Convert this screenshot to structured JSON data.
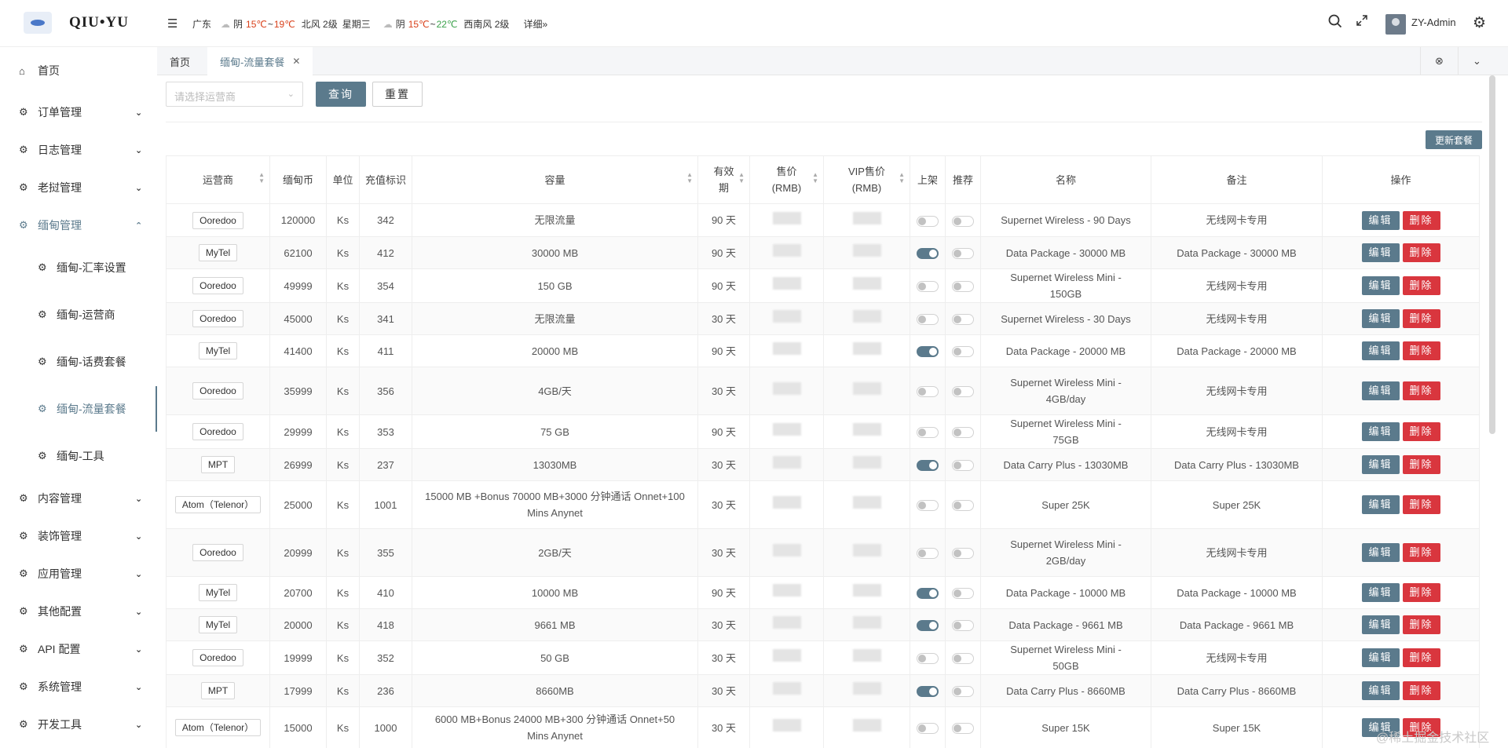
{
  "header": {
    "logo_text": "QIU•YU",
    "weather": {
      "province": "广东",
      "today": {
        "condition": "阴",
        "high": "15℃",
        "sep": "~",
        "low": "19℃",
        "wind": "北风 2级",
        "weekday": "星期三"
      },
      "tomorrow": {
        "condition": "阴",
        "high": "15℃",
        "sep": "~",
        "low": "22℃",
        "wind": "西南风 2级"
      },
      "detail_label": "详细»"
    },
    "user_name": "ZY-Admin"
  },
  "sidebar": {
    "items": [
      {
        "label": "首页"
      },
      {
        "label": "订单管理"
      },
      {
        "label": "日志管理"
      },
      {
        "label": "老挝管理"
      },
      {
        "label": "缅甸管理"
      },
      {
        "label": "内容管理"
      },
      {
        "label": "装饰管理"
      },
      {
        "label": "应用管理"
      },
      {
        "label": "其他配置"
      },
      {
        "label": "API 配置"
      },
      {
        "label": "系统管理"
      },
      {
        "label": "开发工具"
      }
    ],
    "sub_items": [
      {
        "label": "缅甸-汇率设置"
      },
      {
        "label": "缅甸-运营商"
      },
      {
        "label": "缅甸-话费套餐"
      },
      {
        "label": "缅甸-流量套餐"
      },
      {
        "label": "缅甸-工具"
      }
    ]
  },
  "tabs": [
    {
      "label": "首页"
    },
    {
      "label": "缅甸-流量套餐"
    }
  ],
  "filter": {
    "operator_placeholder": "请选择运营商",
    "query_label": "查询",
    "reset_label": "重置"
  },
  "toolbar": {
    "update_label": "更新套餐"
  },
  "table": {
    "headers": {
      "operator": "运营商",
      "coin": "缅甸币",
      "unit": "单位",
      "recharge_id": "充值标识",
      "capacity": "容量",
      "validity": "有效期",
      "price": "售价(RMB)",
      "vip_price": "VIP售价(RMB)",
      "listed": "上架",
      "recommend": "推荐",
      "name": "名称",
      "remark": "备注",
      "actions": "操作"
    },
    "edit_label": "编辑",
    "delete_label": "删除",
    "rows": [
      {
        "operator": "Ooredoo",
        "coin": "120000",
        "unit": "Ks",
        "recharge_id": "342",
        "capacity": "无限流量",
        "validity": "90 天",
        "listed": false,
        "recommend": false,
        "name": "Supernet Wireless - 90 Days",
        "remark": "无线网卡专用"
      },
      {
        "operator": "MyTel",
        "coin": "62100",
        "unit": "Ks",
        "recharge_id": "412",
        "capacity": "30000 MB",
        "validity": "90 天",
        "listed": true,
        "recommend": false,
        "name": "Data Package - 30000 MB",
        "remark": "Data Package - 30000 MB"
      },
      {
        "operator": "Ooredoo",
        "coin": "49999",
        "unit": "Ks",
        "recharge_id": "354",
        "capacity": "150 GB",
        "validity": "90 天",
        "listed": false,
        "recommend": false,
        "name": "Supernet Wireless Mini - 150GB",
        "remark": "无线网卡专用"
      },
      {
        "operator": "Ooredoo",
        "coin": "45000",
        "unit": "Ks",
        "recharge_id": "341",
        "capacity": "无限流量",
        "validity": "30 天",
        "listed": false,
        "recommend": false,
        "name": "Supernet Wireless - 30 Days",
        "remark": "无线网卡专用"
      },
      {
        "operator": "MyTel",
        "coin": "41400",
        "unit": "Ks",
        "recharge_id": "411",
        "capacity": "20000 MB",
        "validity": "90 天",
        "listed": true,
        "recommend": false,
        "name": "Data Package - 20000 MB",
        "remark": "Data Package - 20000 MB"
      },
      {
        "operator": "Ooredoo",
        "coin": "35999",
        "unit": "Ks",
        "recharge_id": "356",
        "capacity": "4GB/天",
        "validity": "30 天",
        "listed": false,
        "recommend": false,
        "name": "Supernet Wireless Mini - 4GB/day",
        "remark": "无线网卡专用"
      },
      {
        "operator": "Ooredoo",
        "coin": "29999",
        "unit": "Ks",
        "recharge_id": "353",
        "capacity": "75 GB",
        "validity": "90 天",
        "listed": false,
        "recommend": false,
        "name": "Supernet Wireless Mini - 75GB",
        "remark": "无线网卡专用"
      },
      {
        "operator": "MPT",
        "coin": "26999",
        "unit": "Ks",
        "recharge_id": "237",
        "capacity": "13030MB",
        "validity": "30 天",
        "listed": true,
        "recommend": false,
        "name": "Data Carry Plus - 13030MB",
        "remark": "Data Carry Plus - 13030MB"
      },
      {
        "operator": "Atom（Telenor）",
        "coin": "25000",
        "unit": "Ks",
        "recharge_id": "1001",
        "capacity": "15000 MB +Bonus 70000 MB+3000 分钟通话 Onnet+100 Mins Anynet",
        "validity": "30 天",
        "listed": false,
        "recommend": false,
        "name": "Super 25K",
        "remark": "Super 25K"
      },
      {
        "operator": "Ooredoo",
        "coin": "20999",
        "unit": "Ks",
        "recharge_id": "355",
        "capacity": "2GB/天",
        "validity": "30 天",
        "listed": false,
        "recommend": false,
        "name": "Supernet Wireless Mini - 2GB/day",
        "remark": "无线网卡专用"
      },
      {
        "operator": "MyTel",
        "coin": "20700",
        "unit": "Ks",
        "recharge_id": "410",
        "capacity": "10000 MB",
        "validity": "90 天",
        "listed": true,
        "recommend": false,
        "name": "Data Package - 10000 MB",
        "remark": "Data Package - 10000 MB"
      },
      {
        "operator": "MyTel",
        "coin": "20000",
        "unit": "Ks",
        "recharge_id": "418",
        "capacity": "9661 MB",
        "validity": "30 天",
        "listed": true,
        "recommend": false,
        "name": "Data Package - 9661 MB",
        "remark": "Data Package - 9661 MB"
      },
      {
        "operator": "Ooredoo",
        "coin": "19999",
        "unit": "Ks",
        "recharge_id": "352",
        "capacity": "50 GB",
        "validity": "30 天",
        "listed": false,
        "recommend": false,
        "name": "Supernet Wireless Mini - 50GB",
        "remark": "无线网卡专用"
      },
      {
        "operator": "MPT",
        "coin": "17999",
        "unit": "Ks",
        "recharge_id": "236",
        "capacity": "8660MB",
        "validity": "30 天",
        "listed": true,
        "recommend": false,
        "name": "Data Carry Plus - 8660MB",
        "remark": "Data Carry Plus - 8660MB"
      },
      {
        "operator": "Atom（Telenor）",
        "coin": "15000",
        "unit": "Ks",
        "recharge_id": "1000",
        "capacity": "6000 MB+Bonus 24000 MB+300 分钟通话 Onnet+50 Mins Anynet",
        "validity": "30 天",
        "listed": false,
        "recommend": false,
        "name": "Super 15K",
        "remark": "Super 15K"
      }
    ]
  },
  "watermark": "@稀土掘金技术社区"
}
